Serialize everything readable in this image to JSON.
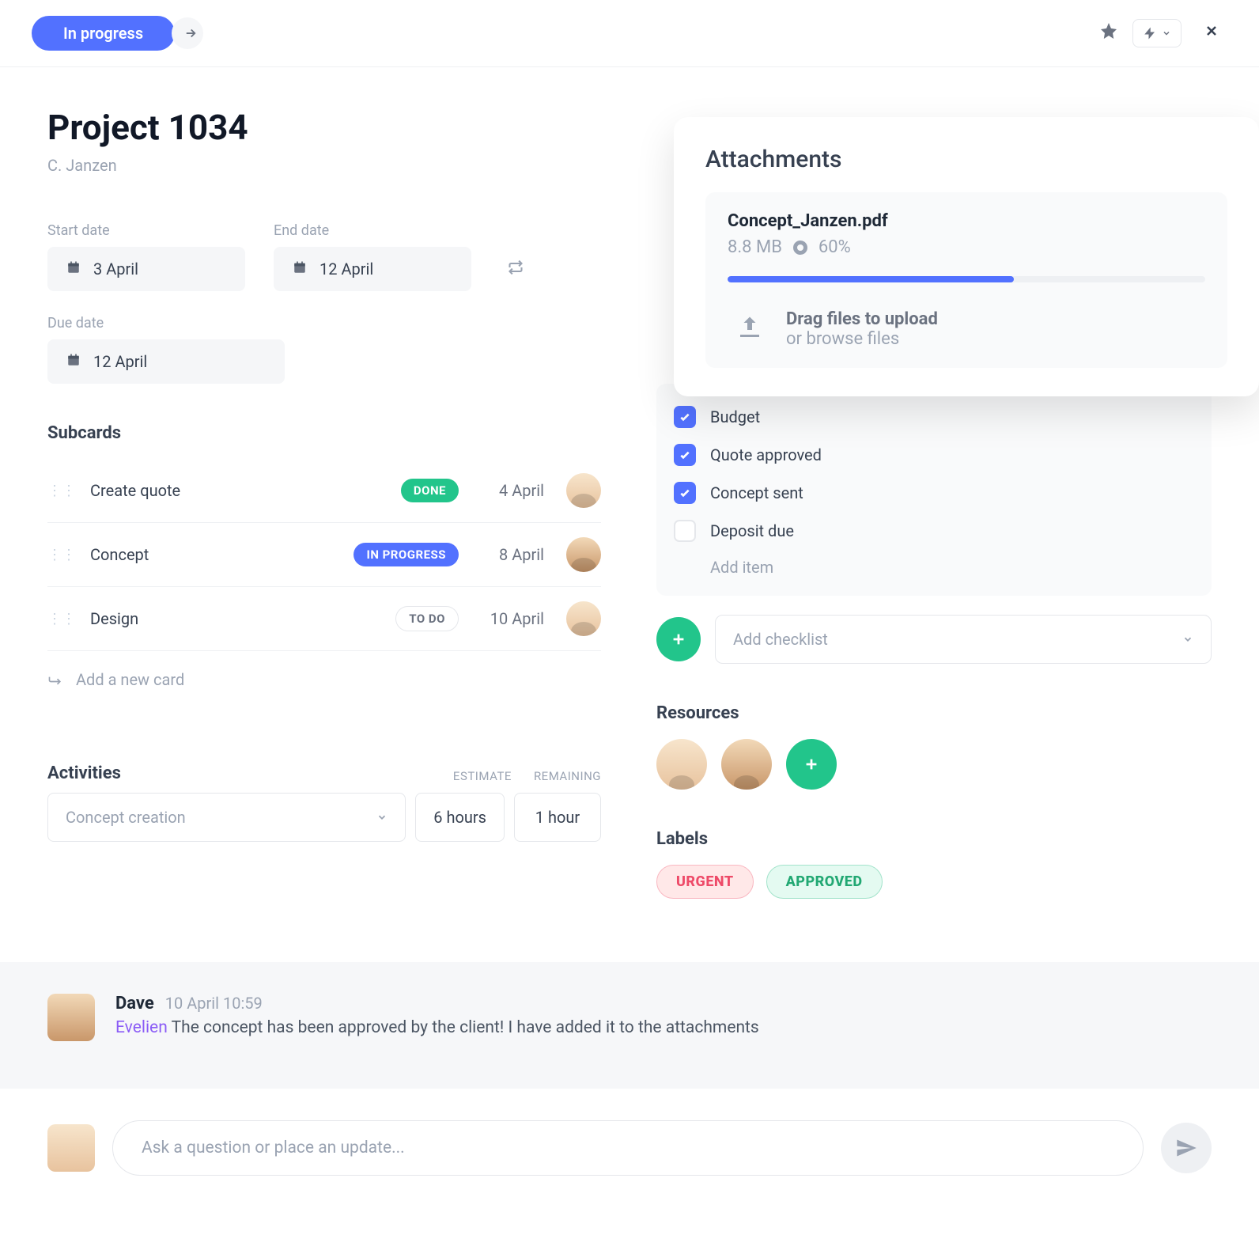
{
  "topbar": {
    "status": "In progress"
  },
  "project": {
    "title": "Project 1034",
    "author": "C. Janzen"
  },
  "dates": {
    "start_label": "Start date",
    "start_value": "3 April",
    "end_label": "End date",
    "end_value": "12 April",
    "due_label": "Due date",
    "due_value": "12 April"
  },
  "subcards": {
    "heading": "Subcards",
    "items": [
      {
        "name": "Create quote",
        "status": "DONE",
        "status_class": "done",
        "date": "4 April",
        "avatar": "female"
      },
      {
        "name": "Concept",
        "status": "IN PROGRESS",
        "status_class": "inprogress",
        "date": "8 April",
        "avatar": "male"
      },
      {
        "name": "Design",
        "status": "TO DO",
        "status_class": "todo",
        "date": "10 April",
        "avatar": "female"
      }
    ],
    "add_label": "Add a new card"
  },
  "activities": {
    "heading": "Activities",
    "col_estimate": "ESTIMATE",
    "col_remaining": "REMAINING",
    "name": "Concept creation",
    "estimate": "6 hours",
    "remaining": "1 hour"
  },
  "attachments": {
    "heading": "Attachments",
    "file_name": "Concept_Janzen.pdf",
    "file_size": "8.8 MB",
    "progress_label": "60%",
    "progress_percent": 60,
    "drop_line1": "Drag files to upload",
    "drop_line2": "or browse files"
  },
  "checklist": {
    "items": [
      {
        "label": "Budget",
        "checked": true
      },
      {
        "label": "Quote approved",
        "checked": true
      },
      {
        "label": "Concept sent",
        "checked": true
      },
      {
        "label": "Deposit due",
        "checked": false
      }
    ],
    "add_item": "Add item",
    "add_checklist": "Add checklist"
  },
  "resources": {
    "heading": "Resources"
  },
  "labels": {
    "heading": "Labels",
    "items": [
      {
        "text": "URGENT",
        "class": "label-urgent"
      },
      {
        "text": "APPROVED",
        "class": "label-approved"
      }
    ]
  },
  "comments": {
    "items": [
      {
        "author": "Dave",
        "time": "10 April 10:59",
        "mention": "Evelien",
        "text": " The concept has been approved by the client! I have added it to the attachments"
      }
    ],
    "compose_placeholder": "Ask a question or place an update..."
  }
}
